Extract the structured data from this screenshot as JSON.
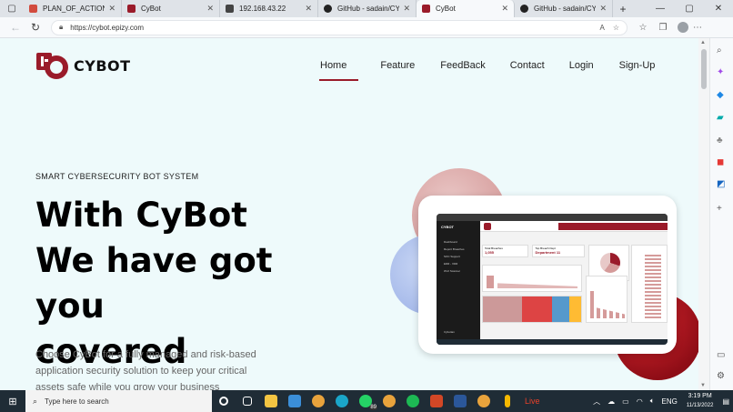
{
  "browser": {
    "tabs": [
      {
        "label": "PLAN_OF_ACTION - P",
        "color": "#d24b3e"
      },
      {
        "label": "CyBot",
        "color": "#9a1b2a"
      },
      {
        "label": "192.168.43.22",
        "color": "#444444"
      },
      {
        "label": "GitHub - sadain/CYBO",
        "color": "#222222"
      },
      {
        "label": "CyBot",
        "color": "#9a1b2a",
        "active": true
      },
      {
        "label": "GitHub - sadain/CYBO",
        "color": "#222222"
      }
    ],
    "url": "https://cybot.epizy.com"
  },
  "site": {
    "brand": "CYBOT",
    "nav": [
      "Home",
      "Feature",
      "FeedBack",
      "Contact",
      "Login",
      "Sign-Up"
    ],
    "eyebrow": "SMART CYBERSECURITY BOT SYSTEM",
    "hero_line1": "With CyBot",
    "hero_line2": "We have got you",
    "hero_line3": "covered",
    "hero_desc": "Choose CyBot for a fully managed and risk-based application security solution to keep your critical assets safe while you grow your business",
    "accent": "#9a1b2a"
  },
  "dashboard": {
    "brand": "CYBOT",
    "menu": [
      "Dashboard",
      "Report Breaches",
      "SOC Support",
      "EDR - XDR",
      "Wi-fi Scanner"
    ],
    "kpi1_label": "Total Breaches",
    "kpi1_value": "1,055",
    "kpi2_label": "Top Breach Dept",
    "kpi2_value": "Department 11",
    "user": "Cybotian"
  },
  "taskbar": {
    "search_placeholder": "Type here to search",
    "live": "Live",
    "lang": "ENG",
    "time": "3:19 PM",
    "date": "11/13/2022",
    "badge": "89"
  }
}
